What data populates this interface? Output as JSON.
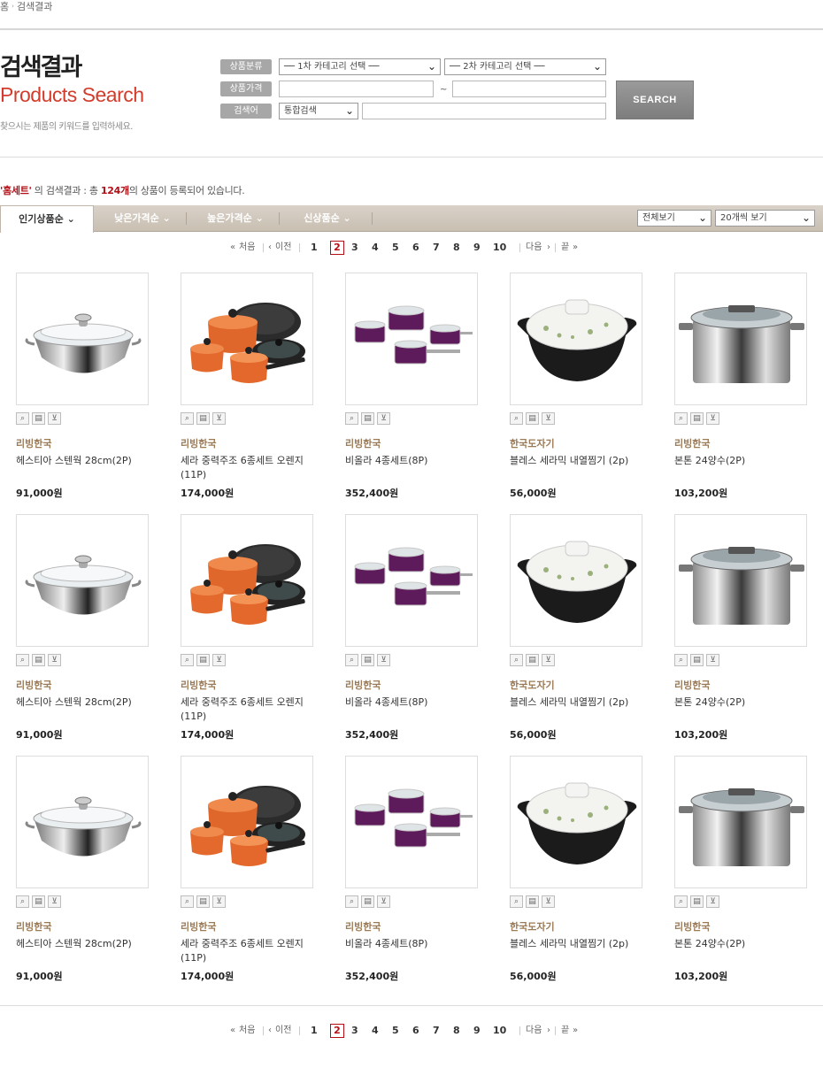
{
  "breadcrumb": {
    "home": "홈",
    "sep": "›",
    "current": "검색결과"
  },
  "header": {
    "title_ko": "검색결과",
    "title_en": "Products Search",
    "subtitle": "찾으시는 제품의 키워드를 입력하세요."
  },
  "form": {
    "category_label": "상품분류",
    "cat1": "── 1차 카테고리 선택 ──",
    "cat2": "── 2차 카테고리 선택 ──",
    "price_label": "상품가격",
    "price_from": "",
    "tilde": "~",
    "price_to": "",
    "keyword_label": "검색어",
    "scope": "통합검색",
    "keyword": "",
    "search_button": "SEARCH"
  },
  "result": {
    "keyword": "'홈세트'",
    "mid1": " 의 검색결과 : 총 ",
    "count": "124개",
    "mid2": "의 상품이 등록되어 있습니다."
  },
  "sort": {
    "tabs": [
      "인기상품순",
      "낮은가격순",
      "높은가격순",
      "신상품순"
    ],
    "active": 0,
    "view_filter": "전체보기",
    "per_page": "20개씩 보기"
  },
  "pagination": {
    "first": "처음",
    "prev": "이전",
    "pages": [
      "1",
      "2",
      "3",
      "4",
      "5",
      "6",
      "7",
      "8",
      "9",
      "10"
    ],
    "current": "2",
    "next": "다음",
    "last": "끝"
  },
  "products": [
    {
      "brand": "리빙한국",
      "name": "헤스티아 스텐웍 28cm(2P)",
      "price": "91,000원",
      "img": "wok-icon"
    },
    {
      "brand": "리빙한국",
      "name": "세라 중력주조 6종세트 오렌지(11P)",
      "price": "174,000원",
      "img": "pot-set-icon"
    },
    {
      "brand": "리빙한국",
      "name": "비올라 4종세트(8P)",
      "price": "352,400원",
      "img": "purple-set-icon"
    },
    {
      "brand": "한국도자기",
      "name": "블레스 세라믹 내열찜기 (2p)",
      "price": "56,000원",
      "img": "ceramic-pot-icon"
    },
    {
      "brand": "리빙한국",
      "name": "본톤 24양수(2P)",
      "price": "103,200원",
      "img": "stock-pot-icon"
    },
    {
      "brand": "리빙한국",
      "name": "헤스티아 스텐웍 28cm(2P)",
      "price": "91,000원",
      "img": "wok-icon"
    },
    {
      "brand": "리빙한국",
      "name": "세라 중력주조 6종세트 오렌지(11P)",
      "price": "174,000원",
      "img": "pot-set-icon"
    },
    {
      "brand": "리빙한국",
      "name": "비올라 4종세트(8P)",
      "price": "352,400원",
      "img": "purple-set-icon"
    },
    {
      "brand": "한국도자기",
      "name": "블레스 세라믹 내열찜기 (2p)",
      "price": "56,000원",
      "img": "ceramic-pot-icon"
    },
    {
      "brand": "리빙한국",
      "name": "본톤 24양수(2P)",
      "price": "103,200원",
      "img": "stock-pot-icon"
    },
    {
      "brand": "리빙한국",
      "name": "헤스티아 스텐웍 28cm(2P)",
      "price": "91,000원",
      "img": "wok-icon"
    },
    {
      "brand": "리빙한국",
      "name": "세라 중력주조 6종세트 오렌지(11P)",
      "price": "174,000원",
      "img": "pot-set-icon"
    },
    {
      "brand": "리빙한국",
      "name": "비올라 4종세트(8P)",
      "price": "352,400원",
      "img": "purple-set-icon"
    },
    {
      "brand": "한국도자기",
      "name": "블레스 세라믹 내열찜기 (2p)",
      "price": "56,000원",
      "img": "ceramic-pot-icon"
    },
    {
      "brand": "리빙한국",
      "name": "본톤 24양수(2P)",
      "price": "103,200원",
      "img": "stock-pot-icon"
    }
  ],
  "colors": {
    "accent": "#b20f16",
    "brand": "#9c7a55",
    "title_en": "#d33c2c",
    "sortbar": "#cfc6ba"
  }
}
